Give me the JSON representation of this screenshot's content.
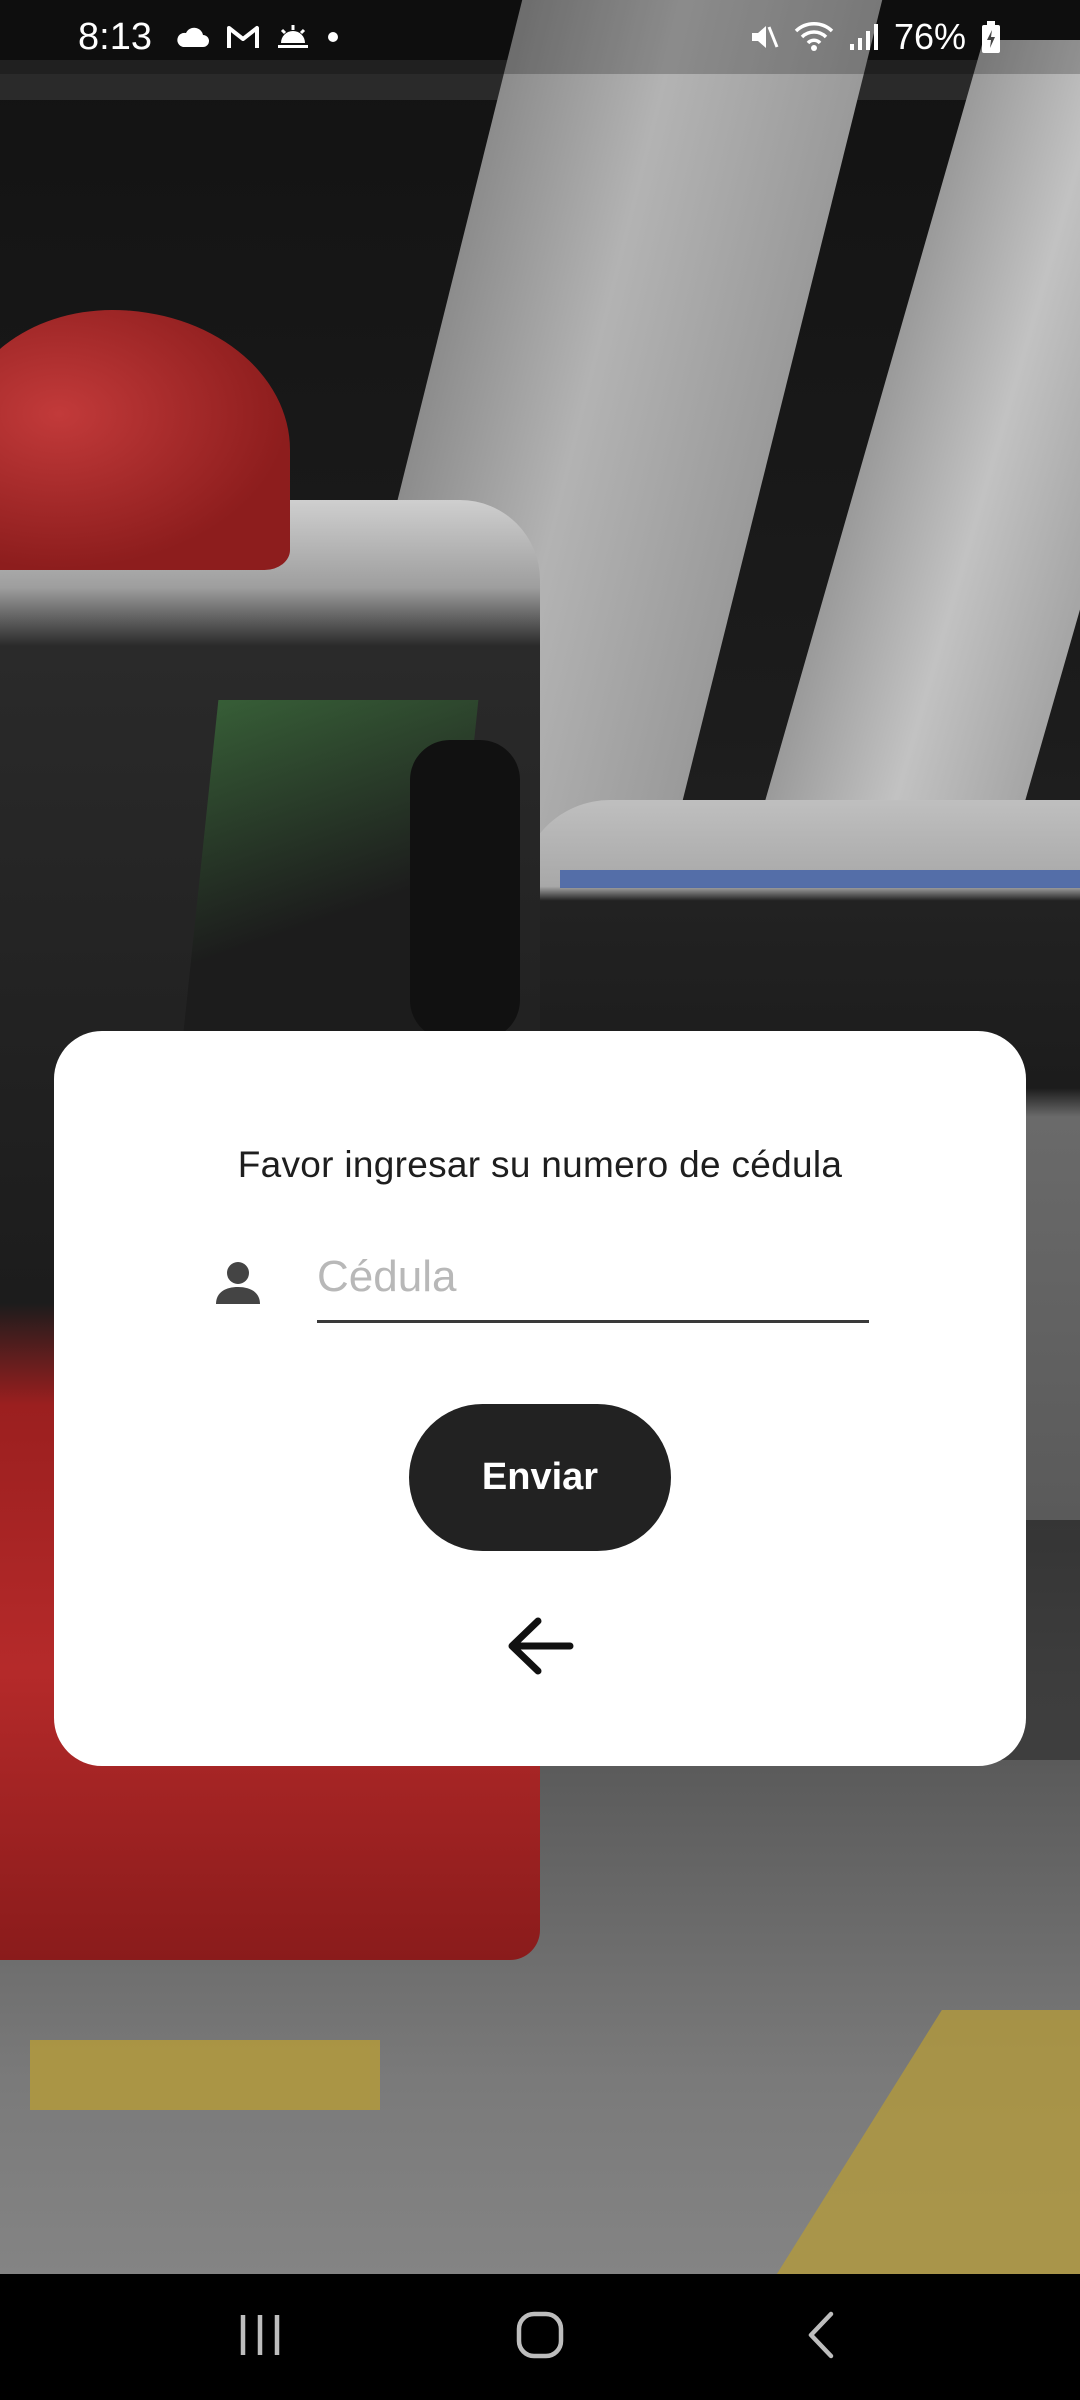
{
  "status_bar": {
    "time": "8:13",
    "battery": "76%",
    "icons": [
      "cloud-icon",
      "gmail-icon",
      "weather-icon",
      "dot-icon",
      "mute-icon",
      "wifi-icon",
      "signal-icon",
      "battery-icon"
    ]
  },
  "dialog": {
    "title": "Favor ingresar su numero de cédula",
    "input": {
      "placeholder": "Cédula",
      "value": "",
      "icon": "person-icon"
    },
    "submit_label": "Enviar",
    "back_icon": "arrow-left-icon"
  },
  "nav_bar": {
    "buttons": [
      "recents-icon",
      "home-icon",
      "back-icon"
    ]
  },
  "colors": {
    "card": "#ffffff",
    "button": "#222222",
    "button_text": "#ffffff",
    "placeholder": "#b8b8b8",
    "navbar": "#000000"
  }
}
